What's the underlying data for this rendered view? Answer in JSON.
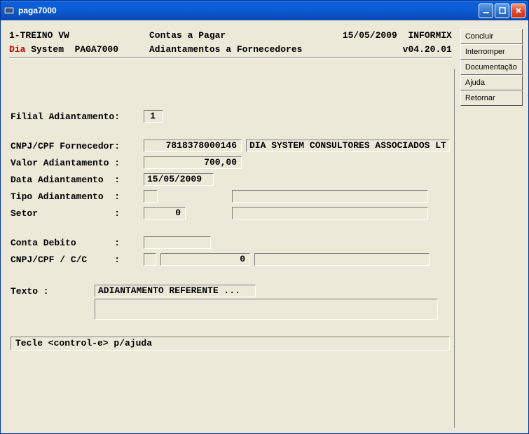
{
  "window": {
    "title": "paga7000"
  },
  "header": {
    "line1_left": "1-TREINO VW",
    "line1_mid": "Contas a Pagar",
    "line1_date": "15/05/2009",
    "line1_db": "INFORMIX",
    "line2_dia": "Dia",
    "line2_system": " System  PAGA7000",
    "line2_mid": "Adiantamentos a Fornecedores",
    "line2_version": "v04.20.01"
  },
  "form": {
    "filial_label": "Filial Adiantamento:",
    "filial_value": "1",
    "cnpj_label": "CNPJ/CPF Fornecedor:",
    "cnpj_value": "7818378000146",
    "cnpj_name": "DIA SYSTEM CONSULTORES ASSOCIADOS LT",
    "valor_label": "Valor Adiantamento :",
    "valor_value": "700,00",
    "data_label": "Data Adiantamento  :",
    "data_value": "15/05/2009",
    "tipo_label": "Tipo Adiantamento  :",
    "tipo_code": "",
    "tipo_desc": "",
    "setor_label": "Setor              :",
    "setor_code": "0",
    "setor_desc": "",
    "conta_label": "Conta Debito       :",
    "conta_value": "",
    "cnpjcc_label": "CNPJ/CPF / C/C     :",
    "cnpjcc_a": "",
    "cnpjcc_b": "0",
    "cnpjcc_desc": "",
    "texto_label": "Texto :",
    "texto_line1": "ADIANTAMENTO REFERENTE ...",
    "texto_line2": "",
    "help_text": "Tecle <control-e> p/ajuda"
  },
  "buttons": {
    "concluir": "Concluir",
    "interromper": "Interromper",
    "documentacao": "Documentação",
    "ajuda": "Ajuda",
    "retornar": "Retornar"
  }
}
